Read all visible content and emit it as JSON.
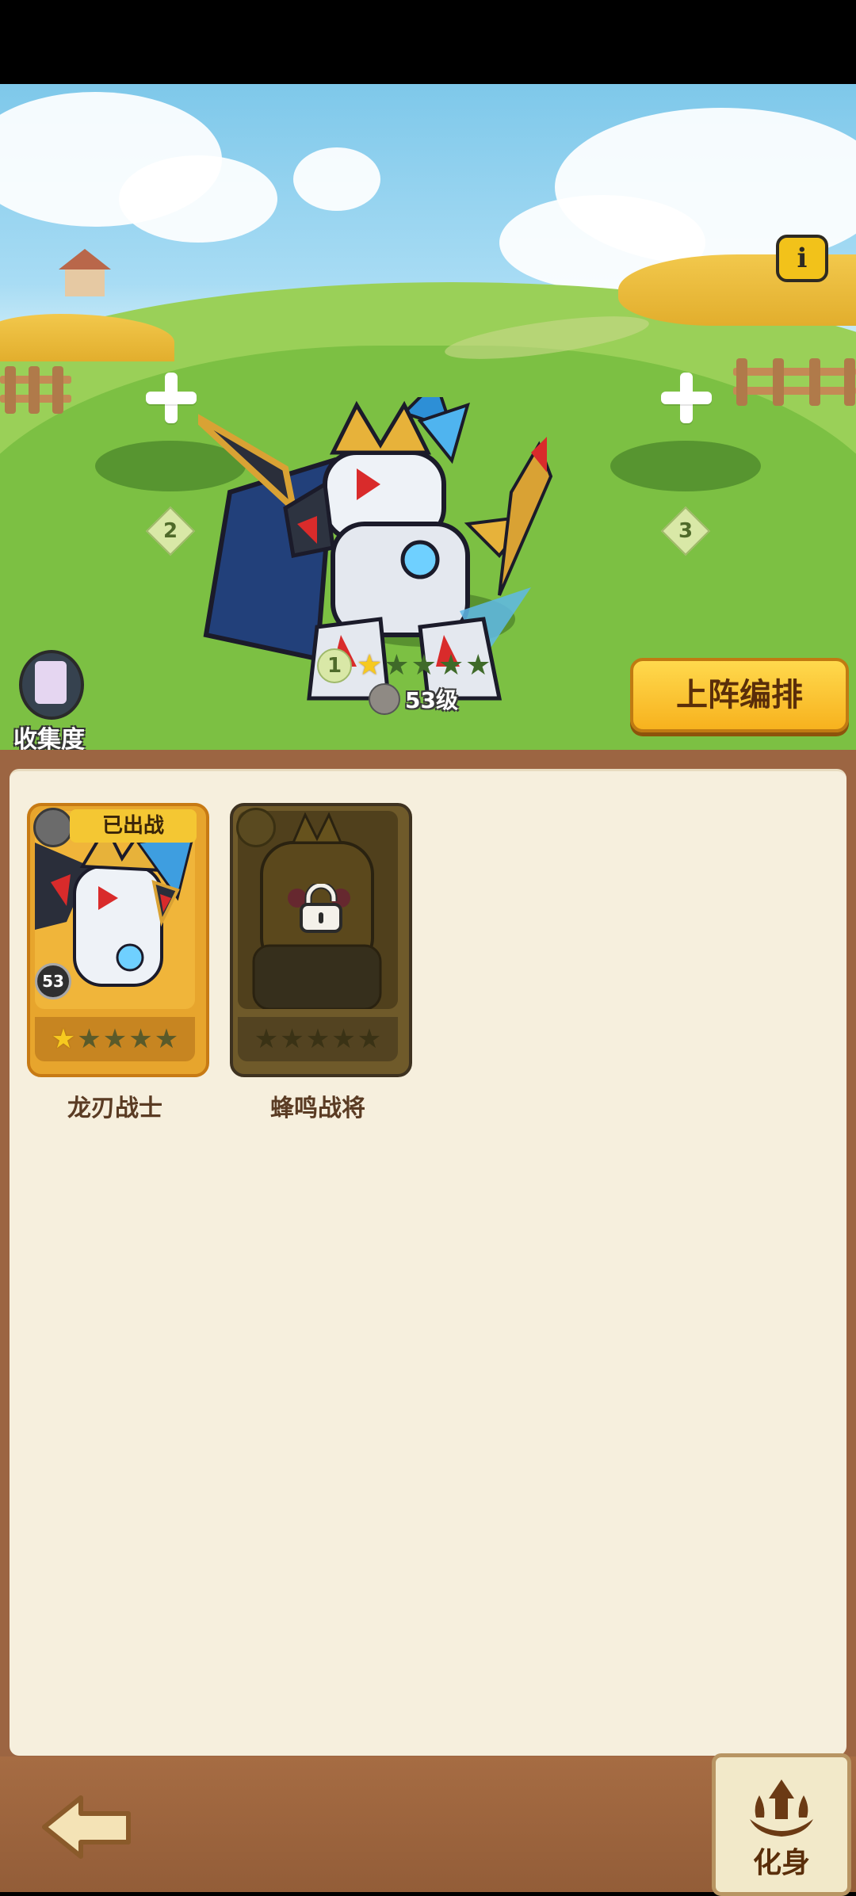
{
  "scene": {
    "slots": [
      {
        "number": "2"
      },
      {
        "number": "3"
      }
    ],
    "collection_label": "收集度",
    "hero": {
      "star_count": "1",
      "stars_filled": 1,
      "stars_total": 5,
      "level_text": "53级"
    },
    "deploy_button_label": "上阵编排"
  },
  "roster": {
    "cards": [
      {
        "name": "龙刃战士",
        "level": "53",
        "deployed_tag": "已出战",
        "stars_filled": 1,
        "stars_total": 5,
        "locked": false
      },
      {
        "name": "蜂鸣战将",
        "stars_filled": 0,
        "stars_total": 5,
        "locked": true
      }
    ]
  },
  "bottom_bar": {
    "avatar_button_label": "化身"
  },
  "colors": {
    "accent_gold": "#f7b21e",
    "panel_bg": "#f6efdd",
    "frame_brown": "#9c6542"
  }
}
